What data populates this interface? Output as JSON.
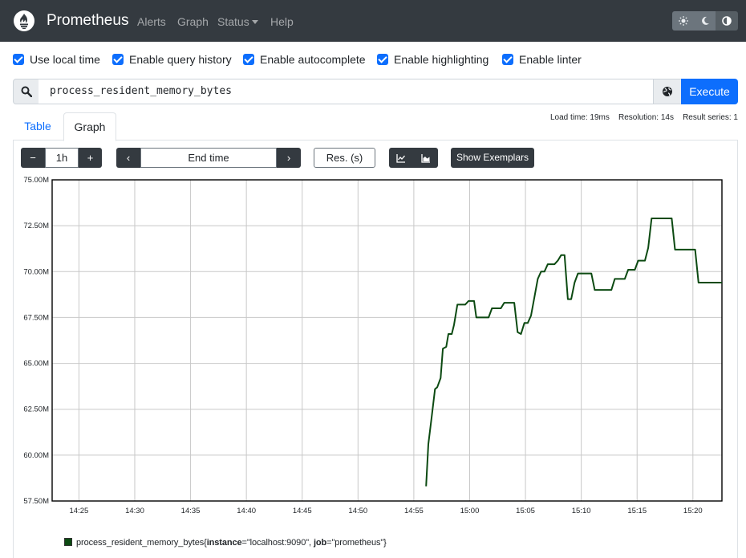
{
  "navbar": {
    "brand": "Prometheus",
    "links": {
      "alerts": "Alerts",
      "graph": "Graph",
      "status": "Status",
      "help": "Help"
    },
    "logo_icon": "prometheus-flame-icon",
    "theme_icons": [
      "sun-icon",
      "moon-icon",
      "contrast-icon"
    ],
    "background": "#343a40"
  },
  "options": {
    "use_local_time": "Use local time",
    "query_history": "Enable query history",
    "autocomplete": "Enable autocomplete",
    "highlighting": "Enable highlighting",
    "linter": "Enable linter"
  },
  "query": {
    "expression": "process_resident_memory_bytes",
    "execute_label": "Execute",
    "search_icon": "search-icon",
    "metrics_icon": "globe-icon"
  },
  "tabs": {
    "table": "Table",
    "graph": "Graph"
  },
  "stats": {
    "load_time": "Load time: 19ms",
    "resolution": "Resolution: 14s",
    "result_series": "Result series: 1"
  },
  "graph_controls": {
    "minus": "−",
    "range": "1h",
    "plus": "+",
    "prev": "‹",
    "end_time_placeholder": "End time",
    "next": "›",
    "resolution_placeholder": "Res. (s)",
    "show_exemplars": "Show Exemplars"
  },
  "legend": {
    "metric": "process_resident_memory_bytes",
    "open": "{",
    "label1_key": "instance",
    "label1_value": "=\"localhost:9090\", ",
    "label2_key": "job",
    "label2_value": "=\"prometheus\"}"
  },
  "chart_data": {
    "type": "line",
    "ylim": [
      57.5,
      75.0
    ],
    "y_unit": "M",
    "y_ticks": [
      "57.50M",
      "60.00M",
      "62.50M",
      "65.00M",
      "67.50M",
      "70.00M",
      "72.50M",
      "75.00M"
    ],
    "x_ticks": [
      "14:25",
      "14:30",
      "14:35",
      "14:40",
      "14:45",
      "14:50",
      "14:55",
      "15:00",
      "15:05",
      "15:10",
      "15:15",
      "15:20"
    ],
    "xlim": [
      "14:22.6",
      "15:22.6"
    ],
    "grid": true,
    "color": "#0c4a12",
    "series": [
      {
        "name": "process_resident_memory_bytes{instance=\"localhost:9090\", job=\"prometheus\"}",
        "x": [
          "14:56.1",
          "14:56.3",
          "14:56.6",
          "14:56.9",
          "14:57.1",
          "14:57.4",
          "14:57.6",
          "14:57.9",
          "14:58.1",
          "14:58.4",
          "14:58.6",
          "14:58.9",
          "14:59.1",
          "14:59.4",
          "14:59.6",
          "14:59.9",
          "15:00.1",
          "15:00.4",
          "15:00.6",
          "15:00.9",
          "15:01.1",
          "15:01.4",
          "15:01.7",
          "15:02.0",
          "15:02.2",
          "15:02.5",
          "15:02.8",
          "15:03.1",
          "15:03.4",
          "15:03.7",
          "15:04.0",
          "15:04.3",
          "15:04.6",
          "15:04.9",
          "15:05.2",
          "15:05.5",
          "15:05.8",
          "15:06.1",
          "15:06.4",
          "15:06.7",
          "15:07.0",
          "15:07.3",
          "15:07.6",
          "15:07.9",
          "15:08.2",
          "15:08.5",
          "15:08.8",
          "15:09.1",
          "15:09.4",
          "15:09.7",
          "15:10.0",
          "15:10.3",
          "15:10.6",
          "15:10.9",
          "15:11.2",
          "15:11.5",
          "15:11.8",
          "15:12.1",
          "15:12.4",
          "15:12.7",
          "15:13.0",
          "15:13.3",
          "15:13.6",
          "15:13.9",
          "15:14.2",
          "15:14.5",
          "15:14.8",
          "15:15.1",
          "15:15.4",
          "15:15.7",
          "15:16.0",
          "15:16.3",
          "15:16.6",
          "15:16.9",
          "15:17.2",
          "15:17.5",
          "15:17.8",
          "15:18.1",
          "15:18.4",
          "15:18.7",
          "15:19.0",
          "15:19.3",
          "15:19.6",
          "15:19.9",
          "15:20.2",
          "15:20.5",
          "15:20.8",
          "15:21.1",
          "15:21.4",
          "15:21.7",
          "15:22.0",
          "15:22.3",
          "15:22.6"
        ],
        "values": [
          58.3,
          60.6,
          62.1,
          63.6,
          63.7,
          64.2,
          65.8,
          65.9,
          66.6,
          66.6,
          67.1,
          68.2,
          68.2,
          68.2,
          68.2,
          68.4,
          68.4,
          68.4,
          67.5,
          67.5,
          67.5,
          67.5,
          67.5,
          68.0,
          68.0,
          68.0,
          68.0,
          68.3,
          68.3,
          68.3,
          68.3,
          66.7,
          66.6,
          67.2,
          67.2,
          67.6,
          68.6,
          69.6,
          70.0,
          70.0,
          70.4,
          70.4,
          70.4,
          70.6,
          70.9,
          70.9,
          68.5,
          68.5,
          69.4,
          69.9,
          69.9,
          69.9,
          69.9,
          69.9,
          69.0,
          69.0,
          69.0,
          69.0,
          69.0,
          69.0,
          69.6,
          69.6,
          69.6,
          69.6,
          70.1,
          70.1,
          70.1,
          70.6,
          70.6,
          70.6,
          71.3,
          72.9,
          72.9,
          72.9,
          72.9,
          72.9,
          72.9,
          72.9,
          71.2,
          71.2,
          71.2,
          71.2,
          71.2,
          71.2,
          71.2,
          69.4,
          69.4,
          69.4,
          69.4,
          69.4,
          69.4,
          69.4,
          69.4
        ]
      }
    ]
  }
}
